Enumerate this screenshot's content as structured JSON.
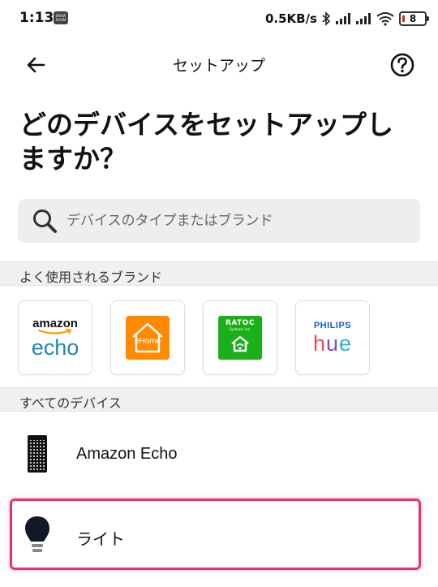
{
  "status_bar": {
    "time": "1:13",
    "app_icon_text": "SHOW ROOM",
    "network_speed": "0.5KB/s",
    "battery_level": "8",
    "battery_color": "#e02020"
  },
  "header": {
    "title": "セットアップ",
    "back_icon": "arrow-left-icon",
    "help_icon": "help-circle-icon"
  },
  "page": {
    "title": "どのデバイスをセットアップしますか？"
  },
  "search": {
    "placeholder": "デバイスのタイプまたはブランド",
    "value": ""
  },
  "brands_section": {
    "title": "よく使用されるブランド",
    "brands": [
      {
        "name": "amazon echo",
        "line1": "amazon",
        "line2": "echo"
      },
      {
        "name": "eHome",
        "label": "eHome"
      },
      {
        "name": "RATOC",
        "label": "RATOC",
        "sub": "Systems, Inc."
      },
      {
        "name": "Philips Hue",
        "line1": "PHILIPS",
        "line2": "hue"
      }
    ]
  },
  "devices_section": {
    "title": "すべてのデバイス",
    "items": [
      {
        "label": "Amazon Echo",
        "icon": "echo-speaker-icon"
      },
      {
        "label": "ライト",
        "icon": "light-bulb-icon"
      }
    ]
  },
  "colors": {
    "accent_highlight": "#e8336a",
    "echo_blue": "#1a8ab8",
    "ehome_orange": "#ff8a00",
    "ratoc_green": "#1bb019",
    "philips_blue": "#0b5ed7"
  }
}
